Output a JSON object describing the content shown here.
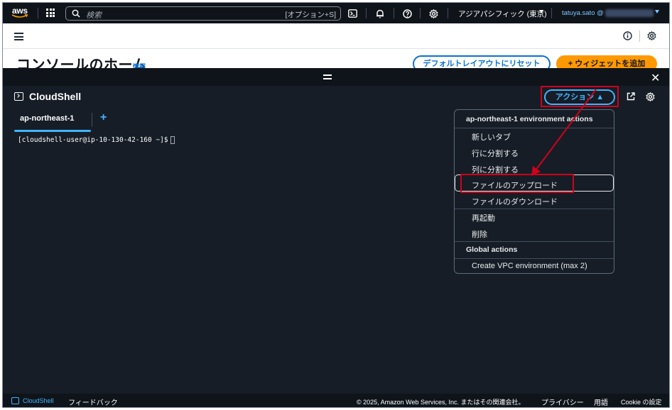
{
  "topnav": {
    "logo_text": "aws",
    "search_placeholder": "検索",
    "search_shortcut": "[オプション+S]",
    "region": "アジアパシフィック (東京)",
    "user": "tatuya.sato @"
  },
  "subheader": {
    "title": "コンソールのホーム",
    "info_link": "情報",
    "reset_button": "デフォルトレイアウトにリセット",
    "add_widget_button": "+ ウィジェットを追加"
  },
  "cloudshell": {
    "title": "CloudShell",
    "actions_button": "アクション ▲",
    "tabs": [
      {
        "label": "ap-northeast-1"
      }
    ],
    "add_tab": "+",
    "prompt": "[cloudshell-user@ip-10-130-42-160 ~]$"
  },
  "menu": {
    "group1": "ap-northeast-1 environment actions",
    "items1": [
      {
        "label": "新しいタブ"
      },
      {
        "label": "行に分割する"
      },
      {
        "label": "列に分割する"
      },
      {
        "label": "ファイルのアップロード"
      },
      {
        "label": "ファイルのダウンロード"
      }
    ],
    "items2": [
      {
        "label": "再起動"
      },
      {
        "label": "削除"
      }
    ],
    "group2": "Global actions",
    "items3": [
      {
        "label": "Create VPC environment (max 2)"
      }
    ]
  },
  "footer": {
    "cloudshell": "CloudShell",
    "feedback": "フィードバック",
    "copyright": "© 2025, Amazon Web Services, Inc. またはその関連会社。",
    "privacy": "プライバシー",
    "terms": "用語",
    "cookie": "Cookie の設定"
  },
  "colors": {
    "nav_bg": "#0f141a",
    "panel_bg": "#161d26",
    "accent_blue": "#42b4ff",
    "link_blue": "#0972d3",
    "orange": "#ff9900",
    "highlight_red": "#d0021b"
  }
}
